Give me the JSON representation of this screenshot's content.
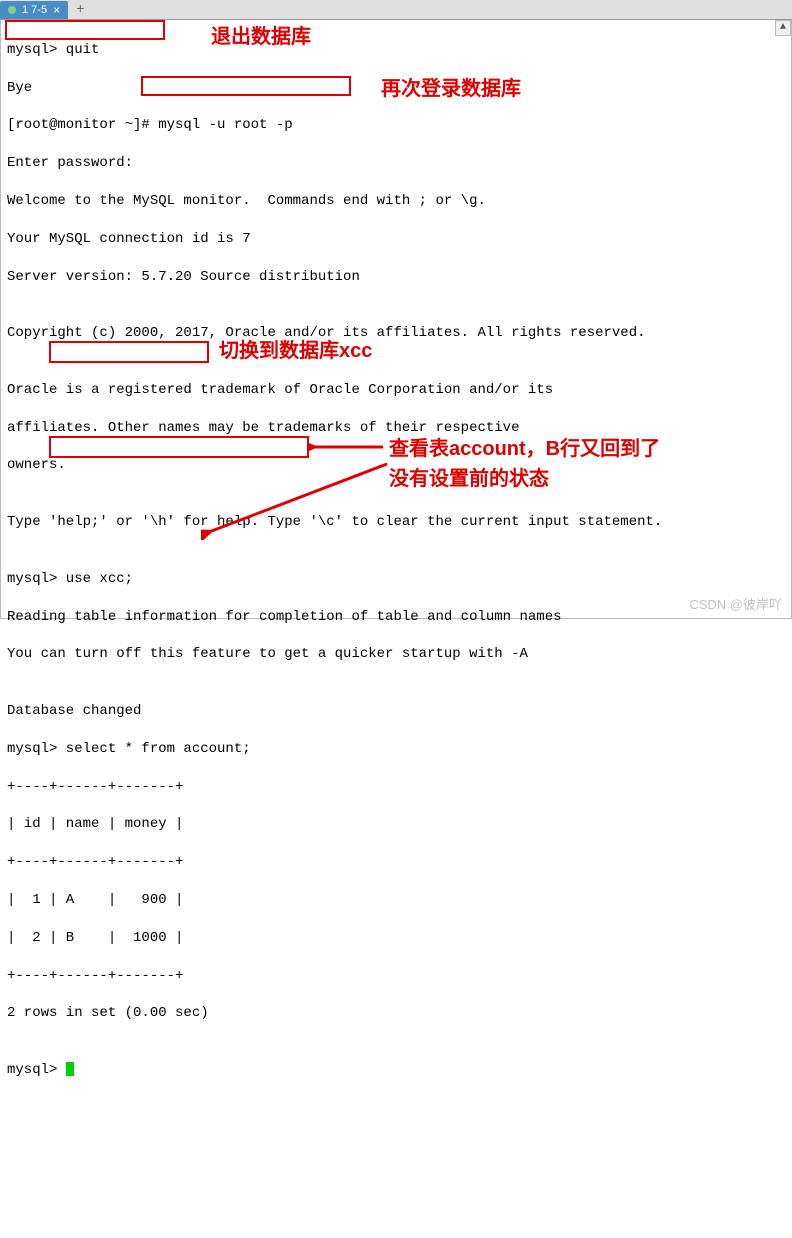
{
  "tab": {
    "label": "1 7-5"
  },
  "lines": {
    "l01": "mysql> quit",
    "l02": "Bye",
    "l03": "[root@monitor ~]# mysql -u root -p",
    "l04": "Enter password:",
    "l05": "Welcome to the MySQL monitor.  Commands end with ; or \\g.",
    "l06": "Your MySQL connection id is 7",
    "l07": "Server version: 5.7.20 Source distribution",
    "l08": "",
    "l09": "Copyright (c) 2000, 2017, Oracle and/or its affiliates. All rights reserved.",
    "l10": "",
    "l11": "Oracle is a registered trademark of Oracle Corporation and/or its",
    "l12": "affiliates. Other names may be trademarks of their respective",
    "l13": "owners.",
    "l14": "",
    "l15": "Type 'help;' or '\\h' for help. Type '\\c' to clear the current input statement.",
    "l16": "",
    "l17": "mysql> use xcc;",
    "l18": "Reading table information for completion of table and column names",
    "l19": "You can turn off this feature to get a quicker startup with -A",
    "l20": "",
    "l21": "Database changed",
    "l22": "mysql> select * from account;",
    "l23": "+----+------+-------+",
    "l24": "| id | name | money |",
    "l25": "+----+------+-------+",
    "l26": "|  1 | A    |   900 |",
    "l27": "|  2 | B    |  1000 |",
    "l28": "+----+------+-------+",
    "l29": "2 rows in set (0.00 sec)",
    "l30": "",
    "l31_prefix": "mysql> "
  },
  "annotations": {
    "a1": "退出数据库",
    "a2": "再次登录数据库",
    "a3": "切换到数据库xcc",
    "a4_line1": "查看表account，B行又回到了",
    "a4_line2": "没有设置前的状态"
  },
  "watermark": "CSDN @彼岸吖",
  "chart_data": {
    "type": "table",
    "title": "account",
    "columns": [
      "id",
      "name",
      "money"
    ],
    "rows": [
      {
        "id": 1,
        "name": "A",
        "money": 900
      },
      {
        "id": 2,
        "name": "B",
        "money": 1000
      }
    ],
    "row_count_text": "2 rows in set (0.00 sec)"
  }
}
